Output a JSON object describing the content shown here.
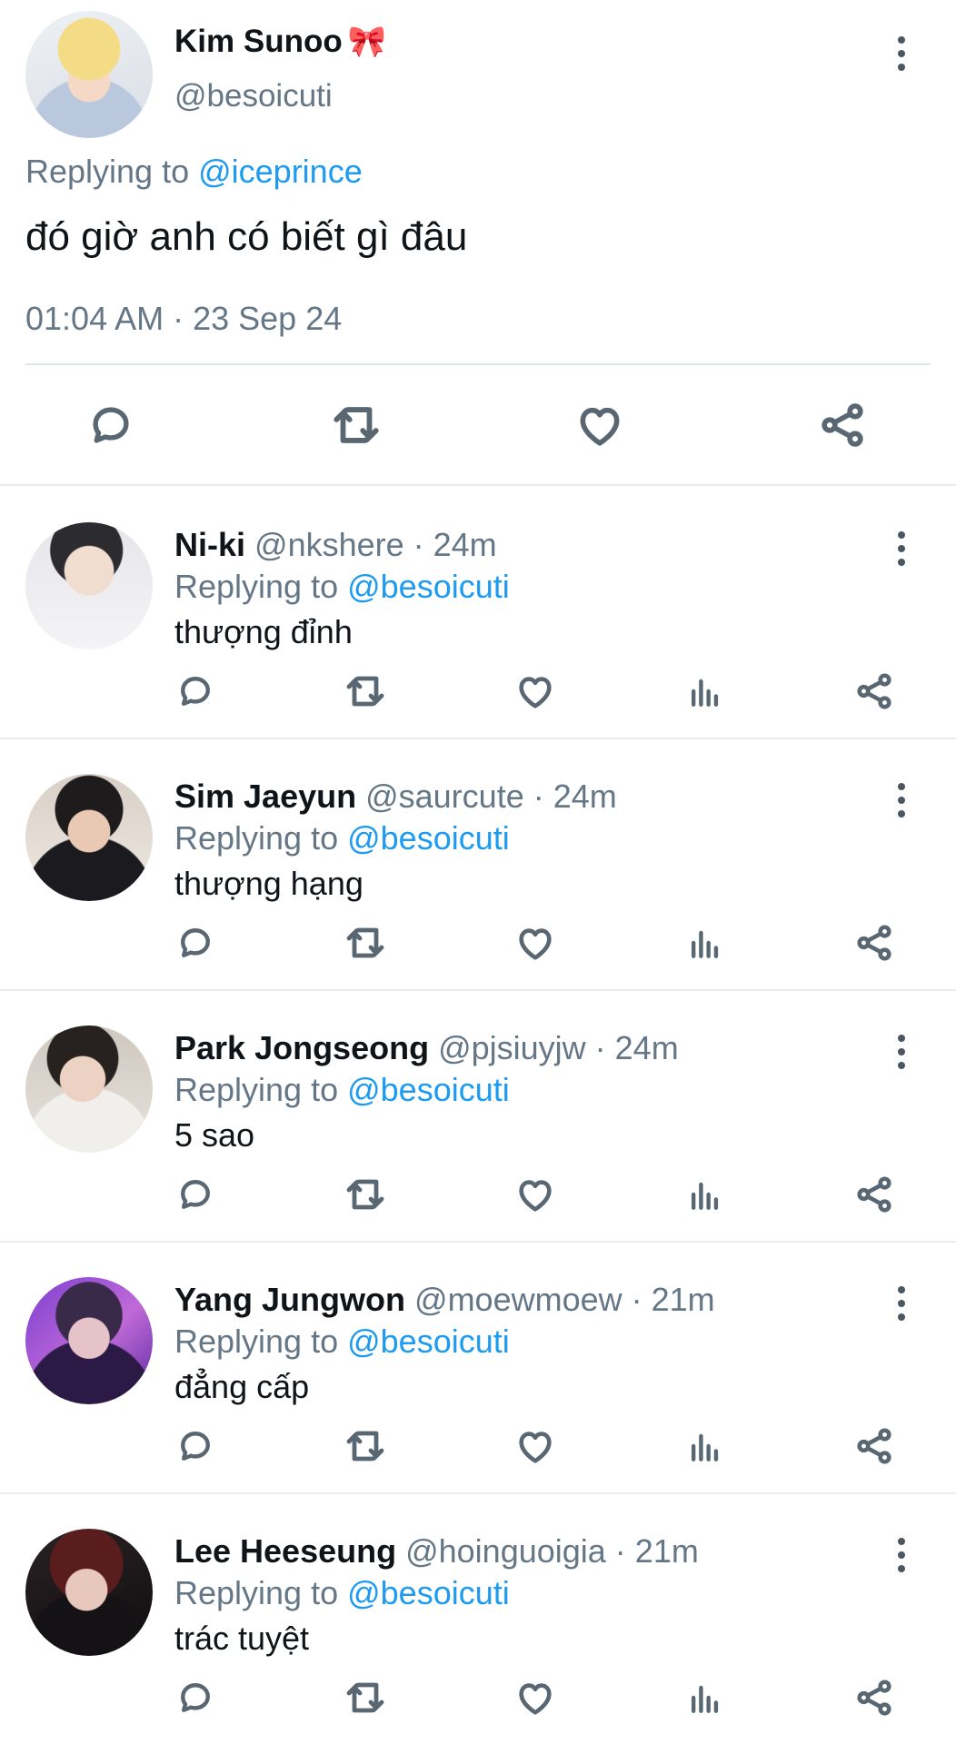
{
  "main_tweet": {
    "name": "Kim Sunoo",
    "handle": "@besoicuti",
    "replying_prefix": "Replying to ",
    "replying_to": "@iceprince",
    "text": "đó giờ anh có biết gì đâu",
    "timestamp": "01:04 AM · 23 Sep 24",
    "icons": [
      "bow-icon",
      "more-icon",
      "reply-icon",
      "retweet-icon",
      "like-icon",
      "share-icon"
    ]
  },
  "replies": [
    {
      "name": "Ni-ki",
      "meta": " @nkshere · 24m",
      "replying_prefix": "Replying to ",
      "replying_to": "@besoicuti",
      "text": "thượng đỉnh"
    },
    {
      "name": "Sim Jaeyun",
      "meta": " @saurcute · 24m",
      "replying_prefix": "Replying to ",
      "replying_to": "@besoicuti",
      "text": "thượng hạng"
    },
    {
      "name": "Park Jongseong",
      "meta": " @pjsiuyjw · 24m",
      "replying_prefix": "Replying to ",
      "replying_to": "@besoicuti",
      "text": "5 sao"
    },
    {
      "name": "Yang Jungwon",
      "meta": " @moewmoew · 21m",
      "replying_prefix": "Replying to ",
      "replying_to": "@besoicuti",
      "text": "đẳng cấp"
    },
    {
      "name": "Lee Heeseung",
      "meta": " @hoinguoigia · 21m",
      "replying_prefix": "Replying to ",
      "replying_to": "@besoicuti",
      "text": "trác tuyệt"
    }
  ],
  "colors": {
    "link": "#1d9bf0",
    "secondary_text": "#657786",
    "icon": "#596773",
    "divider": "#e8ecef"
  }
}
